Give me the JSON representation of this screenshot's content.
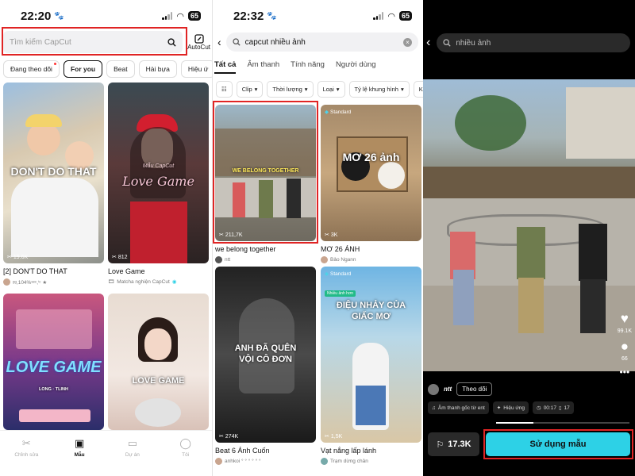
{
  "panel1": {
    "time": "22:20",
    "battery": "65",
    "search": {
      "placeholder": "Tìm kiếm CapCut"
    },
    "autocut_label": "AutoCut",
    "chips": [
      "Đang theo dõi",
      "For you",
      "Beat",
      "Hài bựa",
      "Hiệu ứ"
    ],
    "cards": [
      {
        "title": "[2] DON'T DO THAT",
        "overlay": "DON'T DO THAT",
        "count": "19.6K",
        "author": "ᵍᵍ,104%ˢᵉᶜ,ⁱᶜ ★"
      },
      {
        "title": "Love Game",
        "overlay": "Love Game",
        "overlay_small": "Mẫu CapCut",
        "count": "812",
        "author": "Matcha nghiện CapCut"
      },
      {
        "title": "",
        "overlay": "LOVE GAME",
        "overlay_small": "LONG · TLINH",
        "count": "",
        "author": ""
      },
      {
        "title": "",
        "overlay": "LOVE GAME",
        "count": "",
        "author": ""
      }
    ],
    "tabs": [
      {
        "label": "Chỉnh sửa",
        "icon": "scissors-icon"
      },
      {
        "label": "Mẫu",
        "icon": "template-icon"
      },
      {
        "label": "Dự án",
        "icon": "folder-icon"
      },
      {
        "label": "Tôi",
        "icon": "profile-icon"
      }
    ]
  },
  "panel2": {
    "time": "22:32",
    "battery": "65",
    "search": {
      "value": "capcut nhiều ảnh"
    },
    "tabs": [
      "Tất cả",
      "Âm thanh",
      "Tính năng",
      "Người dùng"
    ],
    "filters": [
      "Clip",
      "Thời lượng",
      "Loại",
      "Tỷ lệ khung hình",
      "Kiể"
    ],
    "cards": [
      {
        "title": "we belong together",
        "overlay": "WE BELONG TOGETHER",
        "count": "211,7K",
        "author": "ntt",
        "badge": ""
      },
      {
        "title": "MƠ 26 ẢNH",
        "overlay": "MƠ 26 ảnh",
        "count": "3K",
        "author": "Bảo Ngann",
        "badge": "Standard"
      },
      {
        "title": "Beat 6 Ảnh Cuốn",
        "overlay": "ANH ĐÃ QUÊN VỘI CÔ ĐƠN",
        "count": "274K",
        "author": "anhkoi ° ° ° ° ° °",
        "badge": ""
      },
      {
        "title": "Vạt nắng lấp lánh",
        "overlay": "ĐIỆU NHẢY CỦA GIẤC MƠ",
        "count": "1,5K",
        "author": "Trạm dừng chân",
        "badge": "Standard",
        "badge2": "Nhiều ảnh hơn"
      }
    ]
  },
  "panel3": {
    "search": {
      "placeholder": "nhiều ảnh"
    },
    "likes": "99.1K",
    "comments": "66",
    "author": "ntt",
    "follow_label": "Theo dõi",
    "meta": [
      "Âm thanh gốc từ ent",
      "Hiệu ứng",
      "00:17",
      "17"
    ],
    "progress_fraction": 0.28,
    "save_count": "17.3K",
    "use_label": "Sử dụng mẫu"
  },
  "colors": {
    "accent": "#2dd1e6",
    "highlight": "#e02424"
  }
}
